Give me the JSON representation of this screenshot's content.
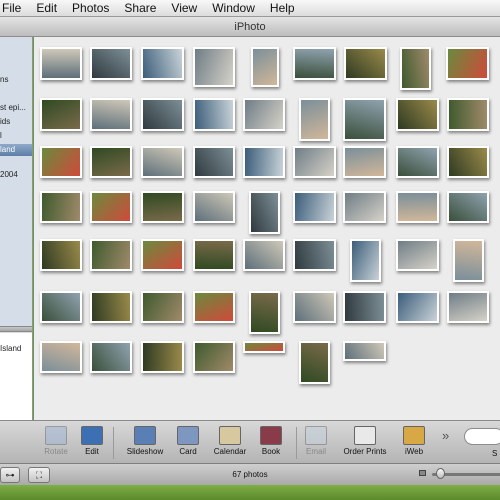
{
  "menubar": {
    "items": [
      "File",
      "Edit",
      "Photos",
      "Share",
      "View",
      "Window",
      "Help"
    ]
  },
  "window": {
    "title": "iPhoto"
  },
  "sidebar": {
    "upper_fragments": [
      "ns",
      "st epi...",
      "ids",
      "l",
      "land",
      "2004"
    ],
    "selected_index": 4,
    "lower_fragments": [
      "Island"
    ]
  },
  "toolbar": {
    "buttons": [
      {
        "label": "Rotate",
        "icon": "rotate-icon",
        "enabled": false
      },
      {
        "label": "Edit",
        "icon": "edit-icon",
        "enabled": true
      },
      {
        "label": "Slideshow",
        "icon": "slideshow-icon",
        "enabled": true
      },
      {
        "label": "Card",
        "icon": "card-icon",
        "enabled": true
      },
      {
        "label": "Calendar",
        "icon": "calendar-icon",
        "enabled": true
      },
      {
        "label": "Book",
        "icon": "book-icon",
        "enabled": true
      },
      {
        "label": "Email",
        "icon": "email-icon",
        "enabled": false
      },
      {
        "label": "Order Prints",
        "icon": "order-prints-icon",
        "enabled": true
      },
      {
        "label": "iWeb",
        "icon": "iweb-icon",
        "enabled": true
      }
    ],
    "more_glyph": "»",
    "search_fragment": "S"
  },
  "status": {
    "photo_count": "67 photos"
  },
  "colors": {
    "sidebar_bg": "#d4dde8",
    "selection": "#6a88b0",
    "viewer_bg": "#ececec",
    "desktop": "#6b9a3a"
  }
}
